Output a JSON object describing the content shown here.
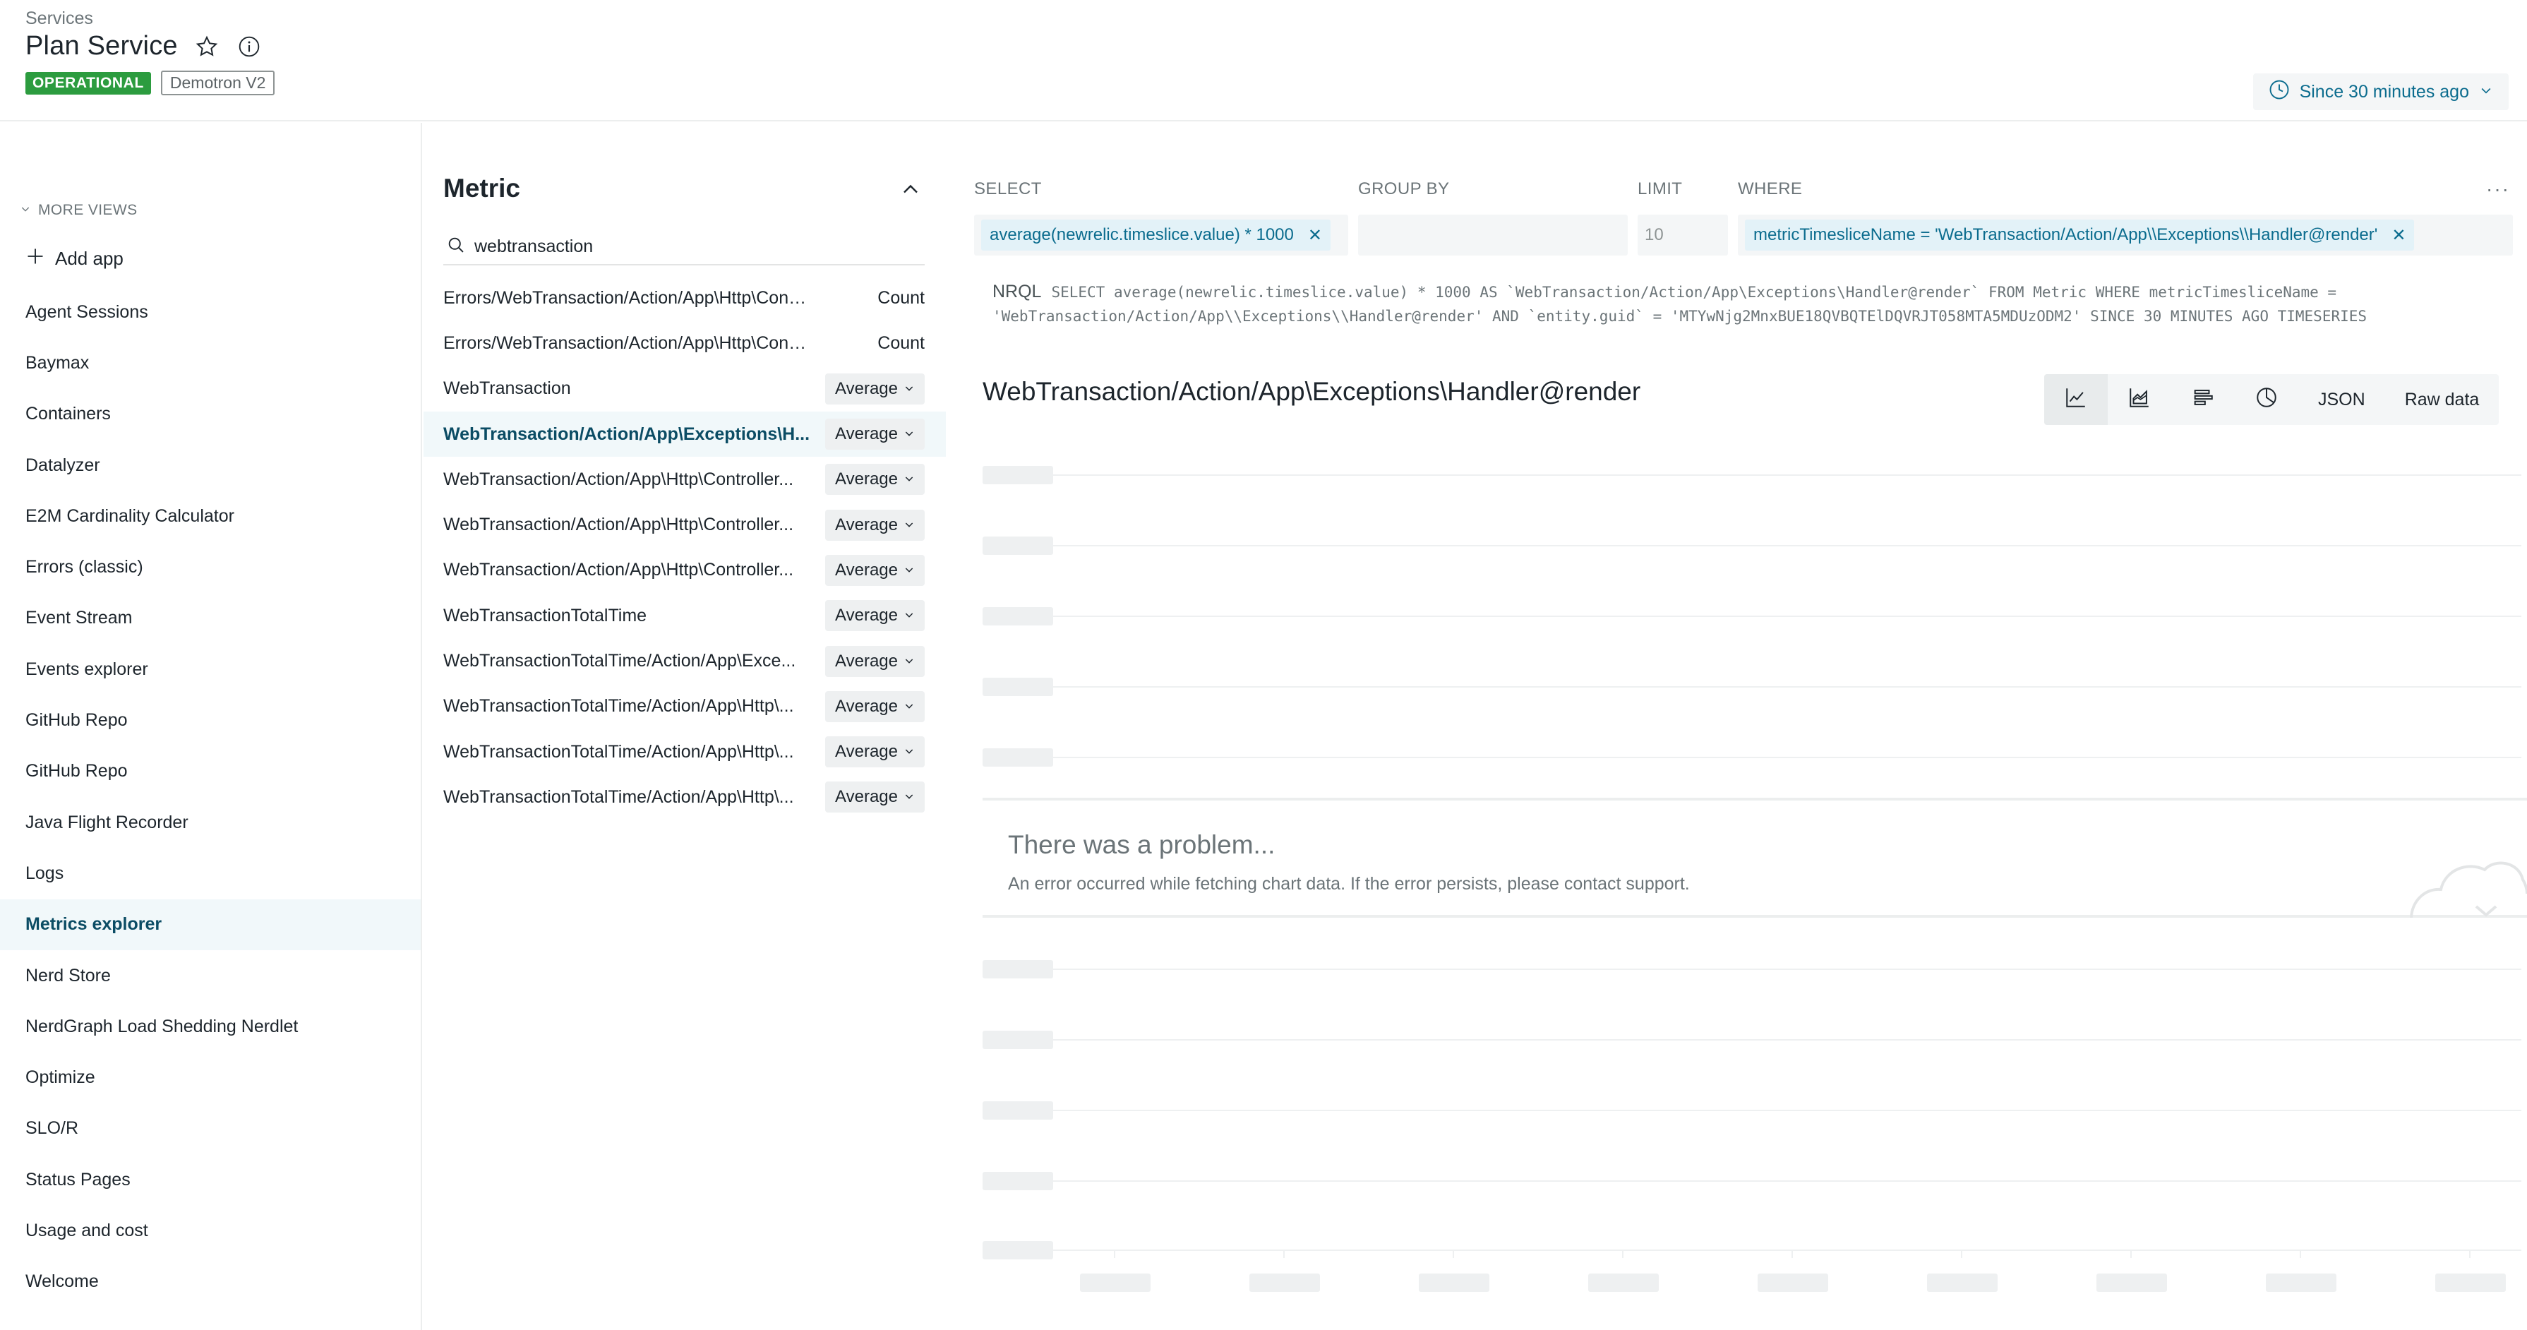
{
  "header": {
    "breadcrumb": "Services",
    "title": "Plan Service",
    "status_badge": "OPERATIONAL",
    "account_badge": "Demotron V2",
    "time_range": "Since 30 minutes ago"
  },
  "sidebar": {
    "more_views_label": "MORE VIEWS",
    "add_app_label": "Add app",
    "items": [
      {
        "label": "Agent Sessions"
      },
      {
        "label": "Baymax"
      },
      {
        "label": "Containers"
      },
      {
        "label": "Datalyzer"
      },
      {
        "label": "E2M Cardinality Calculator"
      },
      {
        "label": "Errors (classic)"
      },
      {
        "label": "Event Stream"
      },
      {
        "label": "Events explorer"
      },
      {
        "label": "GitHub Repo"
      },
      {
        "label": "GitHub Repo"
      },
      {
        "label": "Java Flight Recorder"
      },
      {
        "label": "Logs"
      },
      {
        "label": "Metrics explorer"
      },
      {
        "label": "Nerd Store"
      },
      {
        "label": "NerdGraph Load Shedding Nerdlet"
      },
      {
        "label": "Optimize"
      },
      {
        "label": "SLO/R"
      },
      {
        "label": "Status Pages"
      },
      {
        "label": "Usage and cost"
      },
      {
        "label": "Welcome"
      }
    ],
    "active_item": "Metrics explorer"
  },
  "metric_panel": {
    "heading": "Metric",
    "search_value": "webtransaction",
    "metrics": [
      {
        "name": "Errors/WebTransaction/Action/App\\Http\\Controller...",
        "aggregation": "Count"
      },
      {
        "name": "Errors/WebTransaction/Action/App\\Http\\Controller...",
        "aggregation": "Count"
      },
      {
        "name": "WebTransaction",
        "aggregation": "Average"
      },
      {
        "name": "WebTransaction/Action/App\\Exceptions\\H...",
        "aggregation": "Average"
      },
      {
        "name": "WebTransaction/Action/App\\Http\\Controller...",
        "aggregation": "Average"
      },
      {
        "name": "WebTransaction/Action/App\\Http\\Controller...",
        "aggregation": "Average"
      },
      {
        "name": "WebTransaction/Action/App\\Http\\Controller...",
        "aggregation": "Average"
      },
      {
        "name": "WebTransactionTotalTime",
        "aggregation": "Average"
      },
      {
        "name": "WebTransactionTotalTime/Action/App\\Exce...",
        "aggregation": "Average"
      },
      {
        "name": "WebTransactionTotalTime/Action/App\\Http\\...",
        "aggregation": "Average"
      },
      {
        "name": "WebTransactionTotalTime/Action/App\\Http\\...",
        "aggregation": "Average"
      },
      {
        "name": "WebTransactionTotalTime/Action/App\\Http\\...",
        "aggregation": "Average"
      }
    ],
    "selected_index": 3
  },
  "query": {
    "select_label": "SELECT",
    "group_by_label": "GROUP BY",
    "limit_label": "LIMIT",
    "where_label": "WHERE",
    "select_value": "average(newrelic.timeslice.value) * 1000",
    "limit_value": "10",
    "where_value": "metricTimesliceName = 'WebTransaction/Action/App\\\\Exceptions\\\\Handler@render'",
    "nrql_label": "NRQL",
    "nrql_text": "SELECT average(newrelic.timeslice.value) * 1000 AS `WebTransaction/Action/App\\Exceptions\\Handler@render` FROM Metric WHERE metricTimesliceName = 'WebTransaction/Action/App\\\\Exceptions\\\\Handler@render' AND `entity.guid` = 'MTYwNjg2MnxBUE18QVBQTElDQVRJT058MTA5MDUzODM2' SINCE 30 MINUTES AGO TIMESERIES"
  },
  "chart": {
    "title": "WebTransaction/Action/App\\Exceptions\\Handler@render",
    "viz_buttons": [
      "line-chart-icon",
      "area-chart-icon",
      "bar-chart-icon",
      "pie-chart-icon"
    ],
    "json_label": "JSON",
    "raw_data_label": "Raw data",
    "error_title": "There was a problem...",
    "error_message": "An error occurred while fetching chart data. If the error persists, please contact support."
  },
  "colors": {
    "accent": "#0b6c8e",
    "status_green": "#2c9c3f",
    "active_bg": "#f1f8fa"
  }
}
